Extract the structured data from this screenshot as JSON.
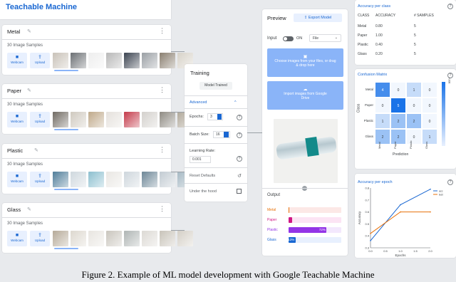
{
  "app": {
    "title": "Teachable Machine"
  },
  "classes": [
    {
      "name": "Metal",
      "samples": "30 Image Samples",
      "webcam": "Webcam",
      "upload": "Upload"
    },
    {
      "name": "Paper",
      "samples": "30 Image Samples",
      "webcam": "Webcam",
      "upload": "Upload"
    },
    {
      "name": "Plastic",
      "samples": "30 Image Samples",
      "webcam": "Webcam",
      "upload": "Upload"
    },
    {
      "name": "Glass",
      "samples": "30 Image Samples",
      "webcam": "Webcam",
      "upload": "Upload"
    }
  ],
  "training": {
    "title": "Training",
    "button": "Model Trained",
    "advanced": "Advanced",
    "epochs_label": "Epochs:",
    "epochs": "3",
    "batch_label": "Batch Size:",
    "batch": "16",
    "lr_label": "Learning Rate:",
    "lr": "0.001",
    "reset": "Reset Defaults",
    "under_hood": "Under the hood"
  },
  "preview": {
    "title": "Preview",
    "export": "Export Model",
    "input_label": "Input",
    "on_label": "ON",
    "source": "File",
    "upload_text": "Choose images from your files, or drag & drop here",
    "drive_text": "Import images from Google Drive",
    "output_label": "Output",
    "outputs": [
      {
        "name": "Metal",
        "value": 0,
        "color": "#e8710a",
        "bg": "#fce8e6"
      },
      {
        "name": "Paper",
        "value": 7,
        "color": "#d01884",
        "bg": "#fce4f4"
      },
      {
        "name": "Plastic",
        "value": 72,
        "color": "#9334e6",
        "bg": "#f3e8fd",
        "label": "72%"
      },
      {
        "name": "Glass",
        "value": 13,
        "color": "#1967d2",
        "bg": "#e8f0fe",
        "label": "13%"
      }
    ]
  },
  "accuracy": {
    "title": "Accuracy per class",
    "headers": [
      "CLASS",
      "ACCURACY",
      "# SAMPLES"
    ],
    "rows": [
      [
        "Metal",
        "0.80",
        "5"
      ],
      [
        "Paper",
        "1.00",
        "5"
      ],
      [
        "Plastic",
        "0.40",
        "5"
      ],
      [
        "Glass",
        "0.20",
        "5"
      ]
    ]
  },
  "confusion": {
    "title": "Confusion Matrix",
    "ylabel": "Class",
    "xlabel": "Prediction",
    "labels": [
      "Metal",
      "Paper",
      "Plastic",
      "Glass"
    ],
    "matrix": [
      [
        4,
        0,
        1,
        0
      ],
      [
        0,
        5,
        0,
        0
      ],
      [
        1,
        2,
        2,
        0
      ],
      [
        2,
        2,
        0,
        1
      ]
    ],
    "scale_max": "4.000"
  },
  "epoch": {
    "title": "Accuracy per epoch",
    "xlabel": "Epochs",
    "ylabel": "Accuracy",
    "legend": [
      "acc",
      "test"
    ]
  },
  "caption": "Figure 2. Example of ML model development with Google Teachable Machine",
  "chart_data": [
    {
      "type": "heatmap",
      "title": "Confusion Matrix",
      "xlabel": "Prediction",
      "ylabel": "Class",
      "categories": [
        "Metal",
        "Paper",
        "Plastic",
        "Glass"
      ],
      "values": [
        [
          4,
          0,
          1,
          0
        ],
        [
          0,
          5,
          0,
          0
        ],
        [
          1,
          2,
          2,
          0
        ],
        [
          2,
          2,
          0,
          1
        ]
      ]
    },
    {
      "type": "line",
      "title": "Accuracy per epoch",
      "xlabel": "Epochs",
      "ylabel": "Accuracy",
      "x": [
        0,
        0.5,
        1,
        1.5,
        2
      ],
      "xticks": [
        "0.0",
        "0.5",
        "1.0",
        "1.5",
        "2.0"
      ],
      "ylim": [
        0.3,
        0.8
      ],
      "yticks": [
        "0.3",
        "0.4",
        "0.5",
        "0.6",
        "0.7",
        "0.8"
      ],
      "series": [
        {
          "name": "acc",
          "x": [
            0,
            1,
            2
          ],
          "values": [
            0.36,
            0.66,
            0.79
          ],
          "color": "#1967d2"
        },
        {
          "name": "test",
          "x": [
            0,
            1,
            2
          ],
          "values": [
            0.42,
            0.6,
            0.6
          ],
          "color": "#e8710a"
        }
      ]
    }
  ]
}
